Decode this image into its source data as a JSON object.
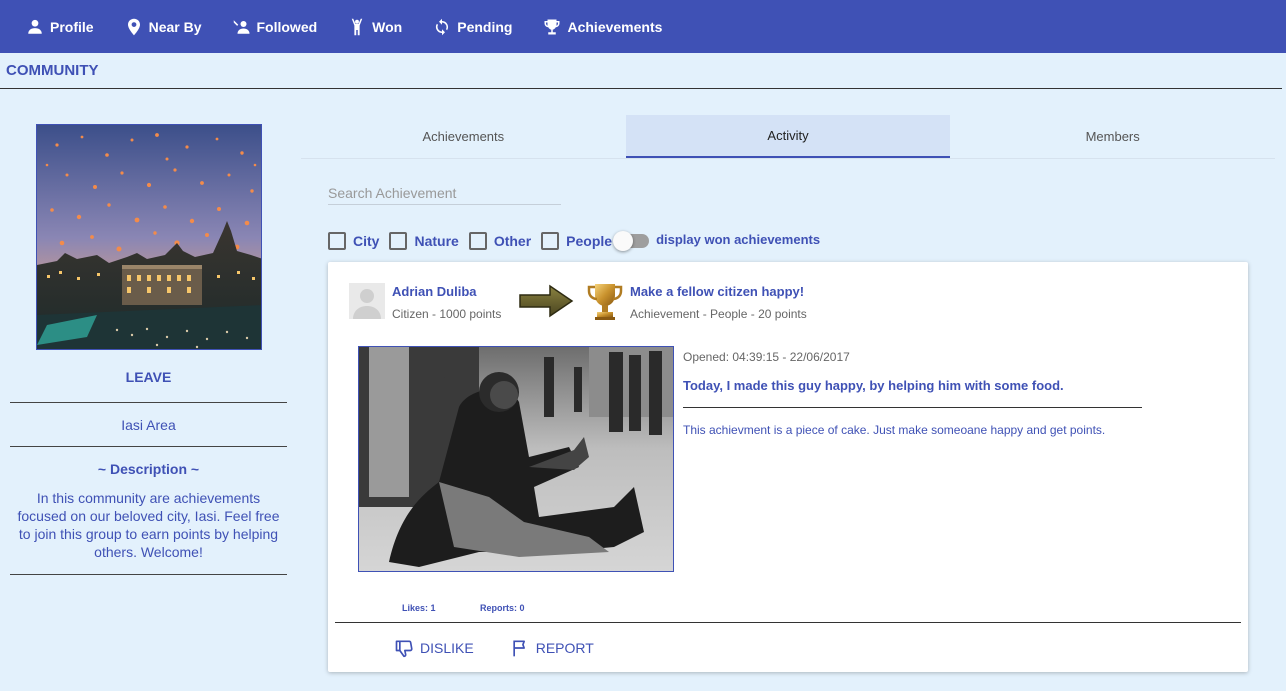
{
  "nav": {
    "items": [
      {
        "label": "Profile",
        "icon": "person-icon"
      },
      {
        "label": "Near By",
        "icon": "location-pin-icon"
      },
      {
        "label": "Followed",
        "icon": "person-follow-icon"
      },
      {
        "label": "Won",
        "icon": "raised-arms-icon"
      },
      {
        "label": "Pending",
        "icon": "refresh-icon"
      },
      {
        "label": "Achievements",
        "icon": "trophy-icon"
      }
    ]
  },
  "page": {
    "title": "COMMUNITY"
  },
  "community": {
    "leave_label": "LEAVE",
    "area": "Iasi Area",
    "description_title": "~ Description ~",
    "description": "In this community are achievements focused on our beloved city, Iasi. Feel free to join this group to earn points by helping others. Welcome!"
  },
  "tabs": [
    {
      "label": "Achievements",
      "active": false
    },
    {
      "label": "Activity",
      "active": true
    },
    {
      "label": "Members",
      "active": false
    }
  ],
  "search": {
    "placeholder": "Search Achievement",
    "value": ""
  },
  "filters": [
    {
      "label": "City",
      "checked": false
    },
    {
      "label": "Nature",
      "checked": false
    },
    {
      "label": "Other",
      "checked": false
    },
    {
      "label": "People",
      "checked": false
    }
  ],
  "toggle": {
    "label": "display won achievements",
    "on": false
  },
  "post": {
    "user_name": "Adrian Duliba",
    "user_sub": "Citizen - 1000 points",
    "achievement_name": "Make a fellow citizen happy!",
    "achievement_sub": "Achievement - People - 20 points",
    "opened": "Opened: 04:39:15 - 22/06/2017",
    "title": "Today, I made this guy happy, by helping him with some food.",
    "body": "This achievment is a piece of cake. Just make someoane happy and get points.",
    "likes": "Likes: 1",
    "reports": "Reports: 0",
    "dislike_label": "DISLIKE",
    "report_label": "REPORT"
  },
  "colors": {
    "primary": "#3f51b5",
    "background": "#e3f1fc",
    "tab_active": "#d4e2f6"
  }
}
